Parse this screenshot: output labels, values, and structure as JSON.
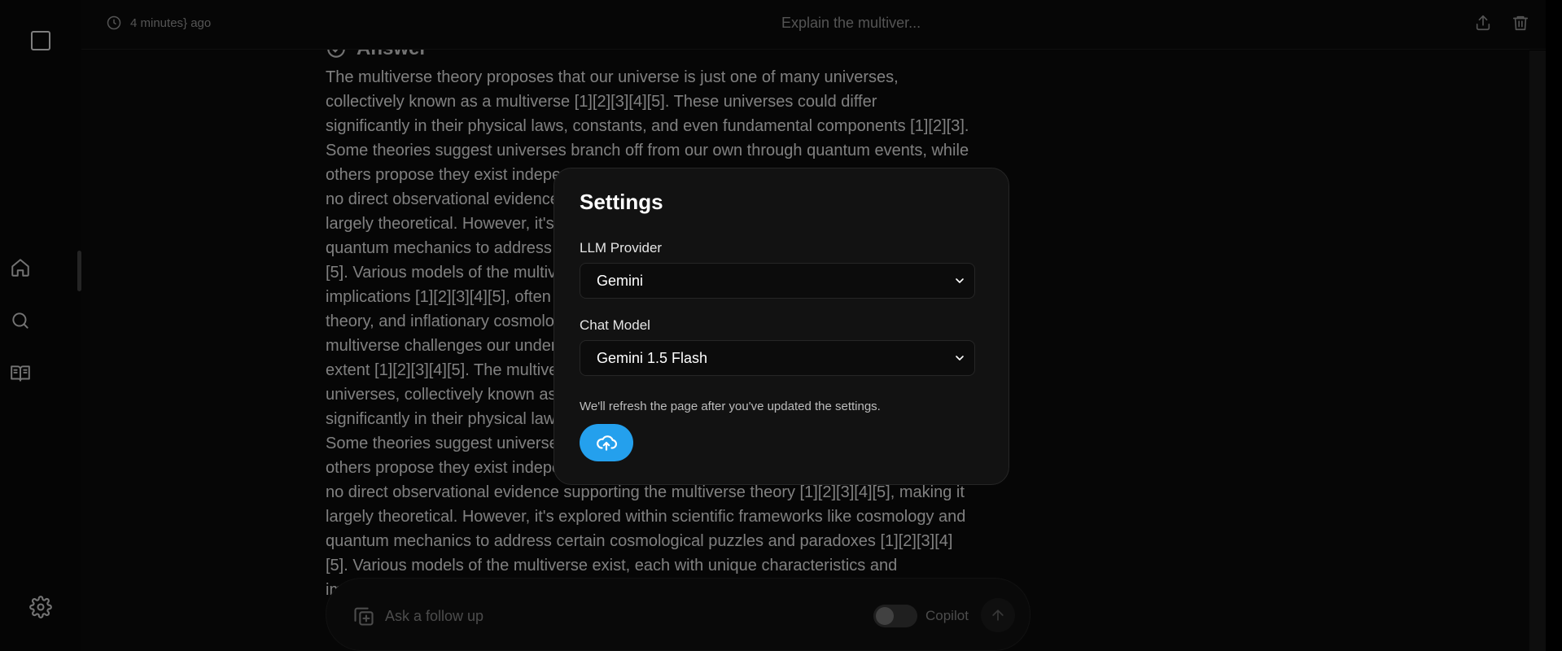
{
  "topbar": {
    "time_ago": "4 minutes} ago",
    "thread_title": "Explain the multiver...",
    "icons": [
      "clock-icon",
      "share-icon",
      "trash-icon"
    ]
  },
  "sidebar": {
    "items": [
      {
        "name": "home",
        "icon": "home-icon"
      },
      {
        "name": "search",
        "icon": "search-icon"
      },
      {
        "name": "library",
        "icon": "book-open-icon"
      }
    ],
    "settings_icon": "gear-icon"
  },
  "answer": {
    "heading": "Answer",
    "text": "The multiverse theory proposes that our universe is just one of many universes,\ncollectively known as a multiverse [1][2][3][4][5]. These universes could differ\nsignificantly in their physical laws, constants, and even fundamental components [1][2][3].\nSome theories suggest universes branch off from our own through quantum events, while\nothers propose they exist independently. There is\nno direct observational evidence supporting the multiverse theory [1][2][3][4][5], making it\nlargely theoretical. However, it's explored within scientific frameworks like cosmology and\nquantum mechanics to address certain cosmological puzzles and paradoxes [1][2][3][4]\n[5]. Various models of the multiverse exist, each with unique characteristics and\nimplications [1][2][3][4][5], often involving concepts like quantum mechanics, string\ntheory, and inflationary cosmology. The concept of a\nmultiverse challenges our understanding of reality and the universe's spatial\nextent [1][2][3][4][5]. The multiverse theory proposes that our universe is just one of many\nuniverses, collectively known as a multiverse [1][2][3][4][5]. These universes could differ\nsignificantly in their physical laws, constants, and even fundamental components [1][2][3].\nSome theories suggest universes branch off from our own through quantum events, while\nothers propose they exist independently. There is\nno direct observational evidence supporting the multiverse theory [1][2][3][4][5], making it\nlargely theoretical. However, it's explored within scientific frameworks like cosmology and\nquantum mechanics to address certain cosmological puzzles and paradoxes [1][2][3][4]\n[5]. Various models of the multiverse exist, each with unique characteristics and\nimplications"
  },
  "followup": {
    "placeholder": "Ask a follow up",
    "copilot_label": "Copilot",
    "copilot_enabled": false
  },
  "settings_modal": {
    "title": "Settings",
    "llm_provider_label": "LLM Provider",
    "llm_provider_value": "Gemini",
    "chat_model_label": "Chat Model",
    "chat_model_value": "Gemini 1.5 Flash",
    "note": "We'll refresh the page after you've updated the settings.",
    "save_icon": "cloud-upload-icon"
  },
  "colors": {
    "accent": "#24a0ed",
    "background": "#0b0b0b",
    "modal_bg": "#121212"
  }
}
